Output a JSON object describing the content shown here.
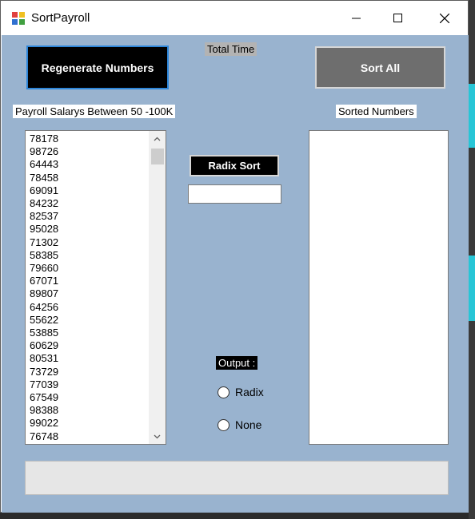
{
  "window": {
    "title": "SortPayroll"
  },
  "buttons": {
    "regenerate": "Regenerate Numbers",
    "sort_all": "Sort All",
    "radix_sort": "Radix Sort"
  },
  "labels": {
    "total_time": "Total Time",
    "payroll": "Payroll Salarys Between 50 -100K",
    "sorted": "Sorted Numbers",
    "output": "Output :"
  },
  "radix_input": {
    "value": ""
  },
  "payroll_numbers": [
    "78178",
    "98726",
    "64443",
    "78458",
    "69091",
    "84232",
    "82537",
    "95028",
    "71302",
    "58385",
    "79660",
    "67071",
    "89807",
    "64256",
    "55622",
    "53885",
    "60629",
    "80531",
    "73729",
    "77039",
    "67549",
    "98388",
    "99022",
    "76748"
  ],
  "sorted_numbers": [],
  "output_options": [
    {
      "label": "Radix",
      "checked": false
    },
    {
      "label": "None",
      "checked": false
    }
  ],
  "progress": {
    "value": 0
  },
  "colors": {
    "client_bg": "#99b3cf",
    "regen_border": "#2e86d9",
    "sort_all_bg": "#6e6e6e"
  }
}
